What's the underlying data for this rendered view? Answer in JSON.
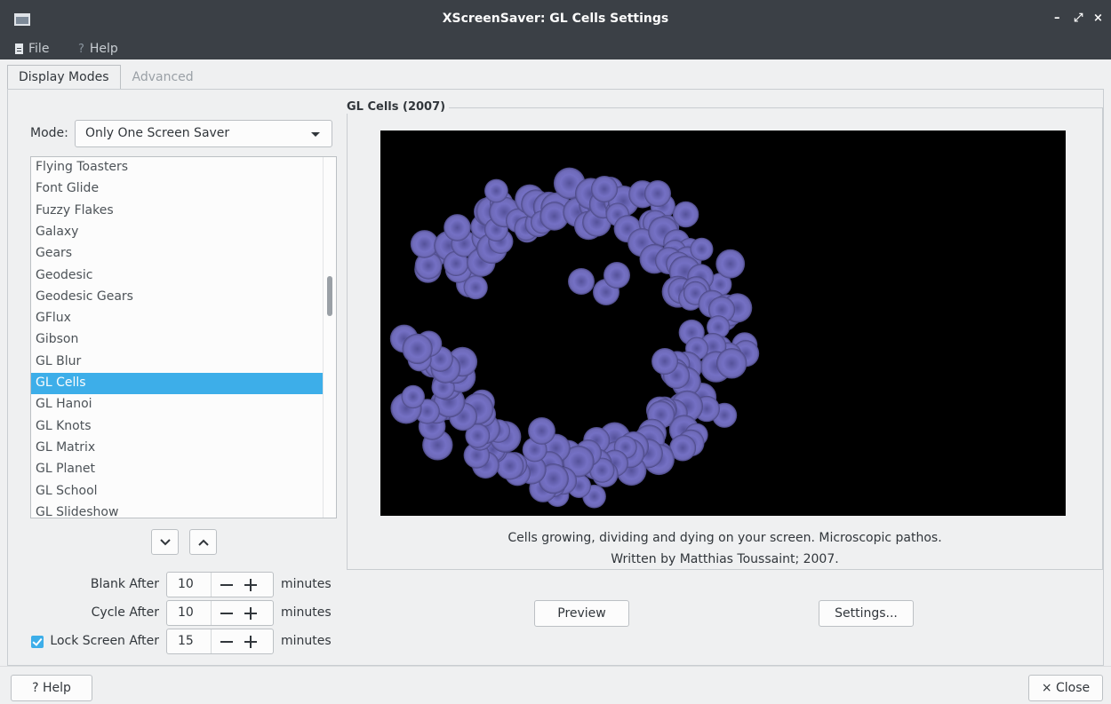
{
  "window": {
    "title": "XScreenSaver: GL Cells Settings"
  },
  "menu": {
    "file": "File",
    "help": "Help"
  },
  "tabs": [
    {
      "label": "Display Modes",
      "active": true
    },
    {
      "label": "Advanced",
      "active": false
    }
  ],
  "mode": {
    "label": "Mode:",
    "value": "Only One Screen Saver"
  },
  "savers": [
    "Flying Toasters",
    "Font Glide",
    "Fuzzy Flakes",
    "Galaxy",
    "Gears",
    "Geodesic",
    "Geodesic Gears",
    "GFlux",
    "Gibson",
    "GL Blur",
    "GL Cells",
    "GL Hanoi",
    "GL Knots",
    "GL Matrix",
    "GL Planet",
    "GL School",
    "GL Slideshow"
  ],
  "selected_saver": "GL Cells",
  "timers": {
    "blank": {
      "label": "Blank After",
      "value": "10",
      "unit": "minutes"
    },
    "cycle": {
      "label": "Cycle After",
      "value": "10",
      "unit": "minutes"
    },
    "lock": {
      "label": "Lock Screen After",
      "value": "15",
      "unit": "minutes",
      "checked": true
    }
  },
  "preview": {
    "title": "GL Cells (2007)",
    "description": "Cells growing, dividing and dying on your screen. Microscopic pathos.",
    "credit": "Written by Matthias Toussaint; 2007."
  },
  "buttons": {
    "preview": "Preview",
    "settings": "Settings...",
    "help": "Help",
    "close": "Close"
  },
  "colors": {
    "accent": "#3daee9",
    "titlebar": "#3b4046",
    "cell": "#7470c4"
  }
}
